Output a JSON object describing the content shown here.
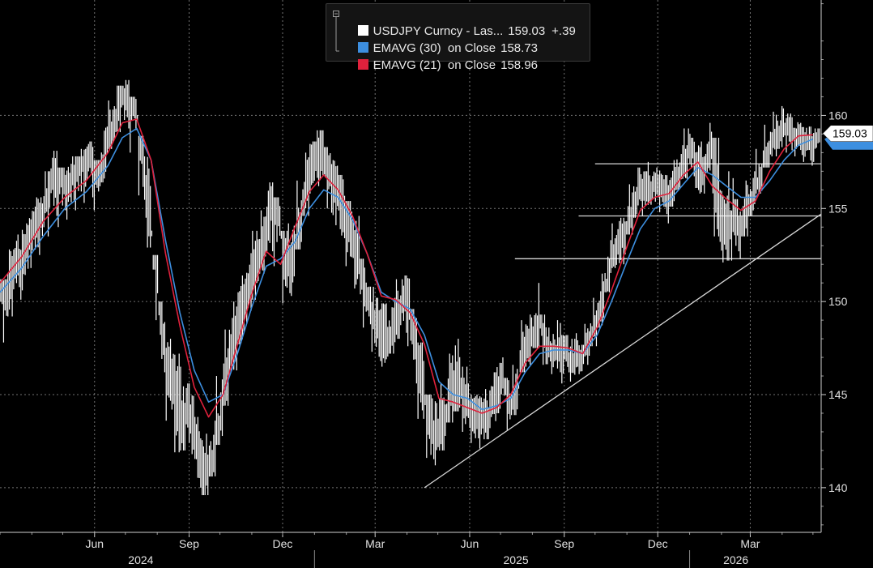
{
  "legend": {
    "items": [
      {
        "name": "USDJPY Curncy - Las...",
        "value": "159.03",
        "change": "+.39",
        "color": "#ffffff"
      },
      {
        "name": "EMAVG (30)  on Close",
        "value": "158.73",
        "color": "#3d8fe0"
      },
      {
        "name": "EMAVG (21)  on Close",
        "value": "158.96",
        "color": "#e0213c"
      }
    ]
  },
  "last_price_tag": "159.03",
  "colors": {
    "background": "#000000",
    "price": "#ffffff",
    "ema30": "#3d8fe0",
    "ema21": "#e0213c",
    "grid": "#cfcfcf",
    "trendline": "#d8d8d8"
  },
  "chart_data": {
    "type": "line",
    "x_axis": {
      "tick_labels": [
        "Jun",
        "Sep",
        "Dec",
        "Mar",
        "Jun",
        "Sep",
        "Dec",
        "Mar"
      ],
      "tick_dates": [
        "2024-06-01",
        "2024-09-01",
        "2024-12-01",
        "2025-03-01",
        "2025-06-01",
        "2025-09-01",
        "2025-12-01",
        "2026-03-01"
      ],
      "year_labels": [
        "2024",
        "2025",
        "2026"
      ],
      "year_dates": [
        "2024-07-16",
        "2025-07-16",
        "2026-02-15"
      ],
      "year_separators": [
        "2025-01-01",
        "2026-01-01"
      ],
      "range": [
        "2024-03-01",
        "2026-05-09"
      ]
    },
    "y_axis": {
      "ticks": [
        140,
        145,
        150,
        155,
        160
      ],
      "range": [
        137.6,
        166.2
      ],
      "position": "right"
    },
    "grid": true,
    "series": [
      {
        "name": "USDJPY Curncy - Las...",
        "style": "daily-bars",
        "color": "#ffffff",
        "x": [
          "2024-03-01",
          "2024-03-08",
          "2024-03-15",
          "2024-03-22",
          "2024-03-29",
          "2024-04-05",
          "2024-04-12",
          "2024-04-19",
          "2024-04-26",
          "2024-05-03",
          "2024-05-10",
          "2024-05-17",
          "2024-05-24",
          "2024-05-31",
          "2024-06-07",
          "2024-06-14",
          "2024-06-21",
          "2024-06-28",
          "2024-07-05",
          "2024-07-12",
          "2024-07-19",
          "2024-07-26",
          "2024-08-02",
          "2024-08-09",
          "2024-08-16",
          "2024-08-23",
          "2024-08-30",
          "2024-09-06",
          "2024-09-13",
          "2024-09-20",
          "2024-09-27",
          "2024-10-04",
          "2024-10-11",
          "2024-10-18",
          "2024-10-25",
          "2024-11-01",
          "2024-11-08",
          "2024-11-15",
          "2024-11-22",
          "2024-11-29",
          "2024-12-06",
          "2024-12-13",
          "2024-12-20",
          "2024-12-27",
          "2025-01-03",
          "2025-01-10",
          "2025-01-17",
          "2025-01-24",
          "2025-01-31",
          "2025-02-07",
          "2025-02-14",
          "2025-02-21",
          "2025-02-28",
          "2025-03-07",
          "2025-03-14",
          "2025-03-21",
          "2025-03-28",
          "2025-04-04",
          "2025-04-11",
          "2025-04-18",
          "2025-04-25",
          "2025-05-02",
          "2025-05-09",
          "2025-05-16",
          "2025-05-23",
          "2025-05-30",
          "2025-06-06",
          "2025-06-13",
          "2025-06-20",
          "2025-06-27",
          "2025-07-04",
          "2025-07-11",
          "2025-07-18",
          "2025-07-25",
          "2025-08-01",
          "2025-08-08",
          "2025-08-15",
          "2025-08-22",
          "2025-08-29",
          "2025-09-05",
          "2025-09-12",
          "2025-09-19",
          "2025-09-26",
          "2025-10-03",
          "2025-10-10",
          "2025-10-17",
          "2025-10-24",
          "2025-10-31",
          "2025-11-07",
          "2025-11-14",
          "2025-11-21",
          "2025-11-28",
          "2025-12-05",
          "2025-12-12",
          "2025-12-19",
          "2025-12-26",
          "2026-01-02",
          "2026-01-09",
          "2026-01-16",
          "2026-01-23",
          "2026-01-30",
          "2026-02-06",
          "2026-02-13",
          "2026-02-20",
          "2026-02-27",
          "2026-03-06",
          "2026-03-13",
          "2026-03-20",
          "2026-03-27",
          "2026-04-03",
          "2026-04-10",
          "2026-04-17",
          "2026-04-24",
          "2026-05-01"
        ],
        "high": [
          151.2,
          152.8,
          153.6,
          154.2,
          155.1,
          155.6,
          157.0,
          158.1,
          157.2,
          157.4,
          157.8,
          158.2,
          158.6,
          157.6,
          159.4,
          160.8,
          161.6,
          161.9,
          161.0,
          158.9,
          157.8,
          152.5,
          150.0,
          148.0,
          147.2,
          146.5,
          145.6,
          143.8,
          142.9,
          143.6,
          146.0,
          148.5,
          150.0,
          151.4,
          152.6,
          153.8,
          154.9,
          156.4,
          155.6,
          153.8,
          154.2,
          156.5,
          158.0,
          158.6,
          159.2,
          158.3,
          157.6,
          156.8,
          155.4,
          154.6,
          152.3,
          150.8,
          150.2,
          149.9,
          150.2,
          151.2,
          151.4,
          149.6,
          147.8,
          145.0,
          144.8,
          145.6,
          147.2,
          148.0,
          146.5,
          145.6,
          145.0,
          145.3,
          146.2,
          147.0,
          145.9,
          146.6,
          149.0,
          149.3,
          151.0,
          149.3,
          148.6,
          149.0,
          148.2,
          148.0,
          148.3,
          148.8,
          150.2,
          151.5,
          153.3,
          154.2,
          154.5,
          156.3,
          157.2,
          157.0,
          157.5,
          157.2,
          156.8,
          157.6,
          158.4,
          159.3,
          158.8,
          158.6,
          159.6,
          158.8,
          156.0,
          157.0,
          155.5,
          156.5,
          157.0,
          158.2,
          159.5,
          160.2,
          160.5,
          160.1,
          159.9,
          159.6,
          159.4,
          159.3
        ],
        "low": [
          147.8,
          149.2,
          150.1,
          150.6,
          151.8,
          152.5,
          153.5,
          154.6,
          154.0,
          154.4,
          154.9,
          155.3,
          155.6,
          154.9,
          156.4,
          158.2,
          159.1,
          159.3,
          158.0,
          155.7,
          152.9,
          149.0,
          146.2,
          143.6,
          141.9,
          142.0,
          141.8,
          140.0,
          139.6,
          140.6,
          142.3,
          144.4,
          146.3,
          147.7,
          148.8,
          150.1,
          151.5,
          152.7,
          151.9,
          149.9,
          150.3,
          152.8,
          154.6,
          155.8,
          156.2,
          155.0,
          154.1,
          153.4,
          151.9,
          150.7,
          148.6,
          147.3,
          146.8,
          146.5,
          147.2,
          148.0,
          147.6,
          145.6,
          143.7,
          141.6,
          141.2,
          142.0,
          143.5,
          144.1,
          143.0,
          142.4,
          142.1,
          142.6,
          143.2,
          144.0,
          143.1,
          143.9,
          146.2,
          146.5,
          147.5,
          146.6,
          146.1,
          146.2,
          145.6,
          145.7,
          146.1,
          146.6,
          147.6,
          148.6,
          150.5,
          151.8,
          152.0,
          153.6,
          154.5,
          154.6,
          155.2,
          154.8,
          154.2,
          155.1,
          156.0,
          156.6,
          156.1,
          155.8,
          156.9,
          153.5,
          152.1,
          152.2,
          152.3,
          153.5,
          154.6,
          155.8,
          157.2,
          157.8,
          158.2,
          158.0,
          157.8,
          157.5,
          157.3,
          157.5
        ],
        "close": [
          150.5,
          151.8,
          152.4,
          153.5,
          154.0,
          154.8,
          156.2,
          157.4,
          156.3,
          156.6,
          157.2,
          157.5,
          157.8,
          156.9,
          158.7,
          159.9,
          161.0,
          161.1,
          160.2,
          156.9,
          154.0,
          150.6,
          147.0,
          145.4,
          143.3,
          144.1,
          143.5,
          141.2,
          140.8,
          141.9,
          144.6,
          146.9,
          148.9,
          150.1,
          151.0,
          152.8,
          153.6,
          155.4,
          154.2,
          151.8,
          152.6,
          155.0,
          157.1,
          157.9,
          158.1,
          156.6,
          155.5,
          154.8,
          153.4,
          152.3,
          150.2,
          149.0,
          148.6,
          148.0,
          148.8,
          150.1,
          149.9,
          147.2,
          145.1,
          143.2,
          142.9,
          143.8,
          145.8,
          145.5,
          144.2,
          143.9,
          143.5,
          144.0,
          145.0,
          145.9,
          144.3,
          145.2,
          147.9,
          148.0,
          149.1,
          147.8,
          147.2,
          147.6,
          147.0,
          146.8,
          147.2,
          147.9,
          149.0,
          149.9,
          152.3,
          153.1,
          153.6,
          155.2,
          156.3,
          155.8,
          156.4,
          155.9,
          155.4,
          156.4,
          157.4,
          158.5,
          157.0,
          157.1,
          158.7,
          155.0,
          153.2,
          154.7,
          153.6,
          155.0,
          156.1,
          156.9,
          158.4,
          158.9,
          159.3,
          159.1,
          158.9,
          158.7,
          158.5,
          159.03
        ]
      },
      {
        "name": "EMAVG (30)  on Close",
        "color": "#3d8fe0",
        "x": [
          "2024-03-01",
          "2024-03-22",
          "2024-04-12",
          "2024-05-03",
          "2024-05-24",
          "2024-06-14",
          "2024-06-28",
          "2024-07-12",
          "2024-07-26",
          "2024-08-09",
          "2024-08-23",
          "2024-09-06",
          "2024-09-20",
          "2024-10-04",
          "2024-10-18",
          "2024-11-01",
          "2024-11-15",
          "2024-11-29",
          "2024-12-13",
          "2024-12-27",
          "2025-01-10",
          "2025-01-24",
          "2025-02-07",
          "2025-02-21",
          "2025-03-07",
          "2025-03-21",
          "2025-04-04",
          "2025-04-18",
          "2025-05-02",
          "2025-05-16",
          "2025-05-30",
          "2025-06-13",
          "2025-06-27",
          "2025-07-11",
          "2025-07-25",
          "2025-08-08",
          "2025-08-22",
          "2025-09-05",
          "2025-09-19",
          "2025-10-03",
          "2025-10-17",
          "2025-10-31",
          "2025-11-14",
          "2025-11-28",
          "2025-12-12",
          "2025-12-26",
          "2026-01-09",
          "2026-01-23",
          "2026-02-06",
          "2026-02-20",
          "2026-03-06",
          "2026-03-20",
          "2026-04-03",
          "2026-04-17",
          "2026-05-01"
        ],
        "y": [
          150.5,
          151.8,
          153.5,
          155.0,
          155.9,
          157.3,
          158.8,
          159.3,
          157.6,
          153.3,
          149.4,
          146.3,
          144.6,
          145.0,
          147.2,
          149.7,
          151.9,
          152.3,
          153.2,
          155.0,
          156.0,
          155.6,
          154.4,
          152.6,
          150.5,
          150.0,
          149.6,
          148.2,
          145.7,
          145.0,
          144.8,
          144.2,
          144.4,
          144.8,
          146.2,
          147.2,
          147.4,
          147.4,
          147.2,
          148.2,
          150.0,
          152.0,
          153.9,
          155.0,
          155.4,
          156.3,
          157.2,
          156.8,
          156.2,
          155.6,
          155.6,
          156.5,
          157.6,
          158.4,
          158.73
        ]
      },
      {
        "name": "EMAVG (21)  on Close",
        "color": "#e0213c",
        "x": [
          "2024-03-01",
          "2024-03-22",
          "2024-04-12",
          "2024-05-03",
          "2024-05-24",
          "2024-06-14",
          "2024-06-28",
          "2024-07-12",
          "2024-07-26",
          "2024-08-09",
          "2024-08-23",
          "2024-09-06",
          "2024-09-20",
          "2024-10-04",
          "2024-10-18",
          "2024-11-01",
          "2024-11-15",
          "2024-11-29",
          "2024-12-13",
          "2024-12-27",
          "2025-01-10",
          "2025-01-24",
          "2025-02-07",
          "2025-02-21",
          "2025-03-07",
          "2025-03-21",
          "2025-04-04",
          "2025-04-18",
          "2025-05-02",
          "2025-05-16",
          "2025-05-30",
          "2025-06-13",
          "2025-06-27",
          "2025-07-11",
          "2025-07-25",
          "2025-08-08",
          "2025-08-22",
          "2025-09-05",
          "2025-09-19",
          "2025-10-03",
          "2025-10-17",
          "2025-10-31",
          "2025-11-14",
          "2025-11-28",
          "2025-12-12",
          "2025-12-26",
          "2026-01-09",
          "2026-01-23",
          "2026-02-06",
          "2026-02-20",
          "2026-03-06",
          "2026-03-20",
          "2026-04-03",
          "2026-04-17",
          "2026-05-01"
        ],
        "y": [
          151.0,
          152.4,
          154.3,
          155.6,
          156.5,
          158.0,
          159.6,
          159.8,
          157.6,
          152.6,
          148.7,
          145.4,
          143.8,
          145.0,
          147.7,
          150.4,
          152.7,
          152.0,
          154.0,
          155.9,
          156.8,
          156.0,
          154.6,
          152.6,
          150.3,
          150.1,
          149.4,
          147.7,
          144.8,
          144.6,
          144.3,
          144.0,
          144.3,
          145.0,
          146.7,
          147.6,
          147.6,
          147.5,
          147.2,
          148.6,
          150.6,
          152.8,
          154.9,
          155.6,
          155.8,
          156.8,
          157.5,
          156.2,
          155.5,
          154.9,
          155.4,
          157.0,
          158.2,
          158.9,
          158.96
        ]
      }
    ],
    "annotations": {
      "horizontal_lines": [
        {
          "y": 157.4,
          "from": "2025-10-01"
        },
        {
          "y": 154.6,
          "from": "2025-09-15"
        },
        {
          "y": 152.3,
          "from": "2025-07-15"
        }
      ],
      "trendline": {
        "from": {
          "x": "2025-04-18",
          "y": 140.0
        },
        "to": {
          "x": "2026-05-09",
          "y": 154.7
        }
      }
    }
  }
}
